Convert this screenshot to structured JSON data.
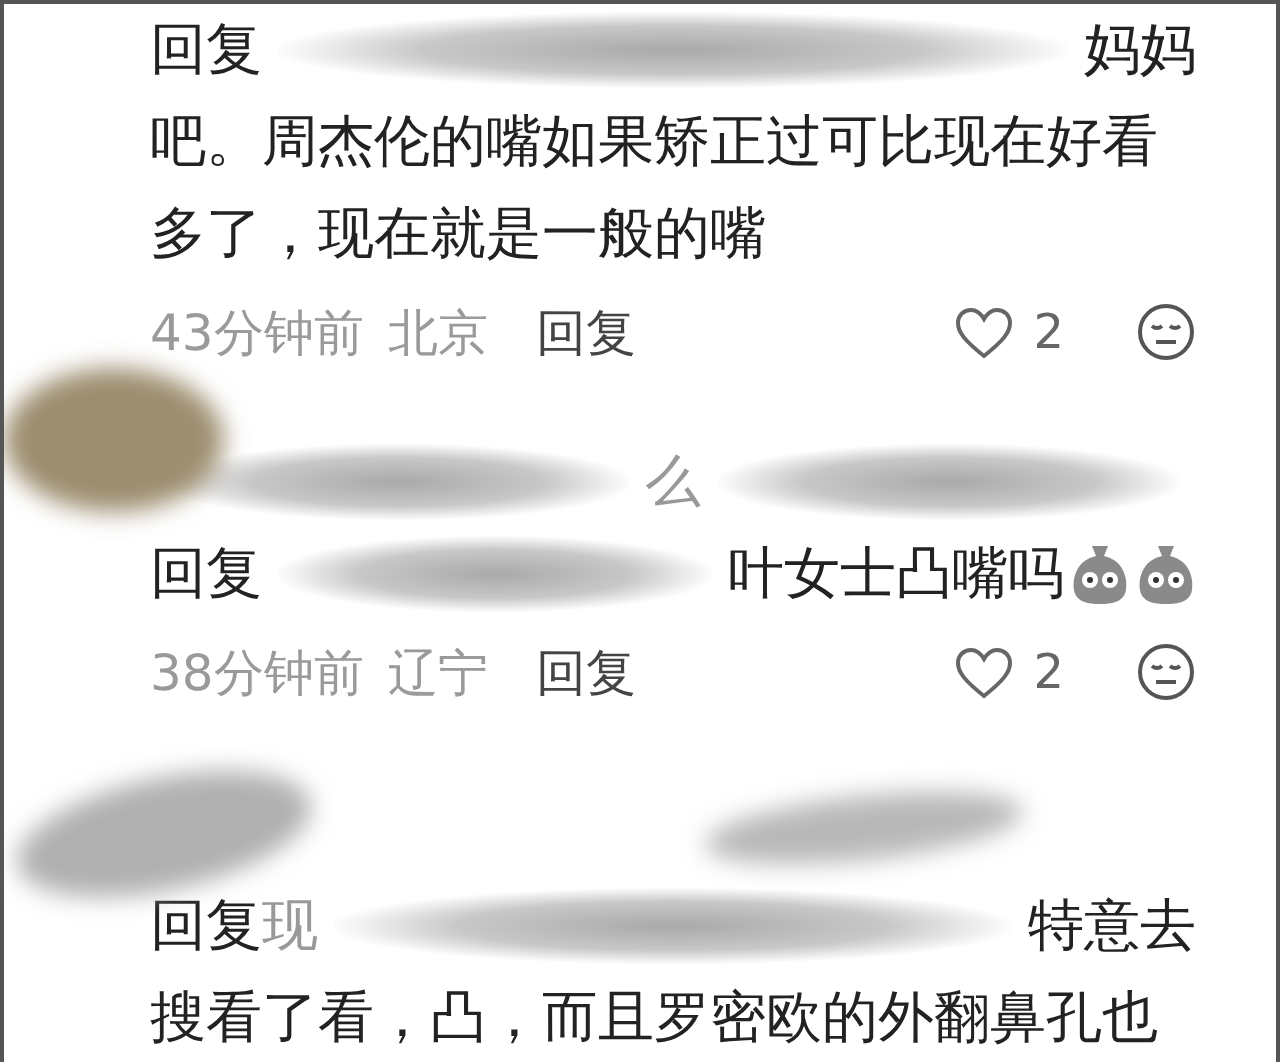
{
  "comments": [
    {
      "lines": [
        {
          "parts": [
            {
              "kind": "text",
              "text": "回复"
            },
            {
              "kind": "redacted"
            },
            {
              "kind": "text",
              "text": "妈妈"
            }
          ]
        },
        {
          "parts": [
            {
              "kind": "text",
              "text": "吧。周杰伦的嘴如果矫正过可比现在好看"
            }
          ]
        },
        {
          "parts": [
            {
              "kind": "text",
              "text": "多了，现在就是一般的嘴"
            }
          ]
        }
      ],
      "meta": {
        "time": "43分钟前",
        "location": "北京",
        "reply": "回复",
        "likes": "2"
      }
    },
    {
      "lines": [
        {
          "parts": [
            {
              "kind": "redacted"
            },
            {
              "kind": "faded",
              "text": "么"
            },
            {
              "kind": "redacted"
            }
          ]
        },
        {
          "parts": [
            {
              "kind": "text",
              "text": "回复"
            },
            {
              "kind": "redacted"
            },
            {
              "kind": "text",
              "text": "叶女士凸嘴吗"
            },
            {
              "kind": "emoji"
            },
            {
              "kind": "emoji"
            }
          ]
        }
      ],
      "meta": {
        "time": "38分钟前",
        "location": "辽宁",
        "reply": "回复",
        "likes": "2"
      }
    },
    {
      "lines": [
        {
          "parts": [
            {
              "kind": "text",
              "text": "回复"
            },
            {
              "kind": "faded",
              "text": "现"
            },
            {
              "kind": "redacted"
            },
            {
              "kind": "text",
              "text": "特意去"
            }
          ]
        },
        {
          "parts": [
            {
              "kind": "text",
              "text": "搜看了看，凸，而且罗密欧的外翻鼻孔也"
            }
          ]
        }
      ]
    }
  ]
}
